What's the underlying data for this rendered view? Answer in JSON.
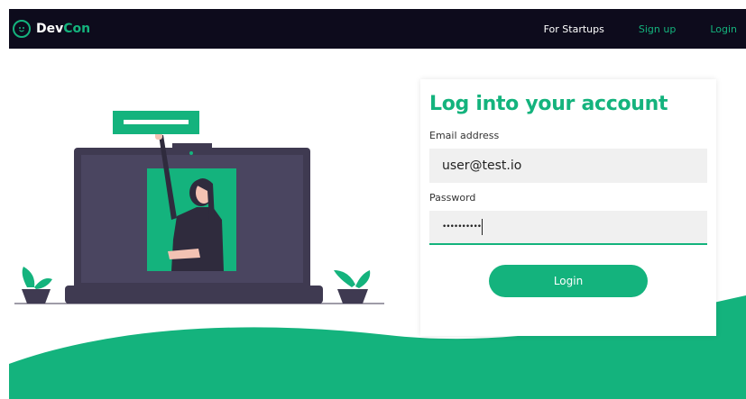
{
  "brand": {
    "prefix": "Dev",
    "suffix": "Con",
    "logo_icon": "smiley-circle-icon"
  },
  "nav": {
    "for_startups": "For Startups",
    "sign_up": "Sign up",
    "login": "Login"
  },
  "login_form": {
    "title": "Log into your account",
    "email_label": "Email address",
    "email_value": "user@test.io",
    "password_label": "Password",
    "password_value": "••••••••••",
    "submit_label": "Login"
  },
  "colors": {
    "accent": "#14b37d",
    "navbar_bg": "#0d0b1c",
    "laptop": "#3f3a51",
    "input_bg": "#f0f0f0"
  }
}
